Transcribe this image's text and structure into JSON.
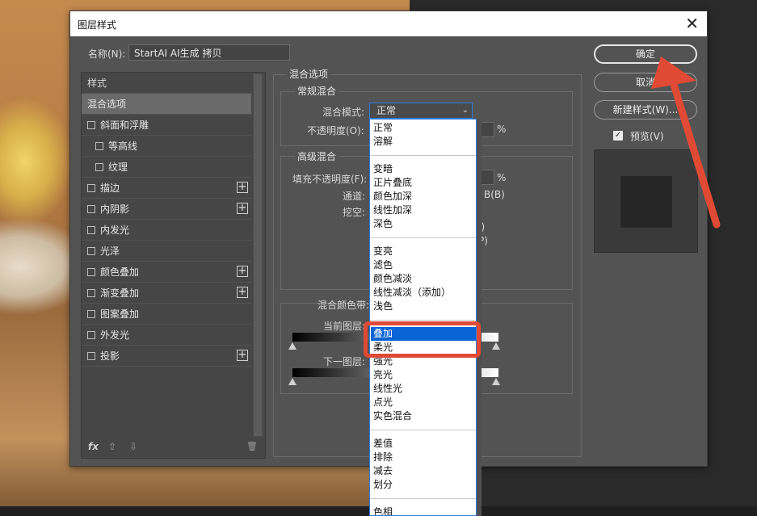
{
  "dialog": {
    "title": "图层样式",
    "close_glyph": "✕",
    "name_label": "名称(N):",
    "name_value": "StartAI AI生成 拷贝"
  },
  "styles": {
    "header": "样式",
    "selected": "混合选项",
    "items": [
      {
        "label": "斜面和浮雕",
        "plus": false
      },
      {
        "label": "等高线",
        "plus": false,
        "indent": true
      },
      {
        "label": "纹理",
        "plus": false,
        "indent": true
      },
      {
        "label": "描边",
        "plus": true
      },
      {
        "label": "内阴影",
        "plus": true
      },
      {
        "label": "内发光",
        "plus": false
      },
      {
        "label": "光泽",
        "plus": false
      },
      {
        "label": "颜色叠加",
        "plus": true
      },
      {
        "label": "渐变叠加",
        "plus": true
      },
      {
        "label": "图案叠加",
        "plus": false
      },
      {
        "label": "外发光",
        "plus": false
      },
      {
        "label": "投影",
        "plus": true
      }
    ],
    "plus_glyph": "+",
    "footer": {
      "fx": "fx",
      "up": "⇧",
      "down": "⇩",
      "trash": "🗑"
    }
  },
  "blending": {
    "section_title": "混合选项",
    "general": {
      "title": "常规混合",
      "mode_label": "混合模式:",
      "mode_value": "正常",
      "opacity_label": "不透明度(O):",
      "percent": "%"
    },
    "advanced": {
      "title": "高级混合",
      "fill_opacity_label": "填充不透明度(F):",
      "percent": "%",
      "channels_label": "通道:",
      "channel_b": "B(B)",
      "knockout_label": "挖空:",
      "partial_1": "I)",
      "partial_2": "P)"
    },
    "blend_if": {
      "label": "混合颜色带:",
      "this_layer": "当前图层:",
      "underlying": "下一图层:"
    }
  },
  "dropdown": {
    "groups": [
      [
        "正常",
        "溶解"
      ],
      [
        "变暗",
        "正片叠底",
        "颜色加深",
        "线性加深",
        "深色"
      ],
      [
        "变亮",
        "滤色",
        "颜色减淡",
        "线性减淡（添加）",
        "浅色"
      ],
      [
        "叠加",
        "柔光",
        "强光",
        "亮光",
        "线性光",
        "点光",
        "实色混合"
      ],
      [
        "差值",
        "排除",
        "减去",
        "划分"
      ],
      [
        "色相"
      ]
    ],
    "highlighted": "叠加"
  },
  "buttons": {
    "ok": "确定",
    "cancel": "取消",
    "new_style": "新建样式(W)...",
    "preview_label": "预览(V)",
    "preview_checked": true
  },
  "colors": {
    "accent_red": "#e04a34",
    "selection_blue": "#0a64d6"
  }
}
